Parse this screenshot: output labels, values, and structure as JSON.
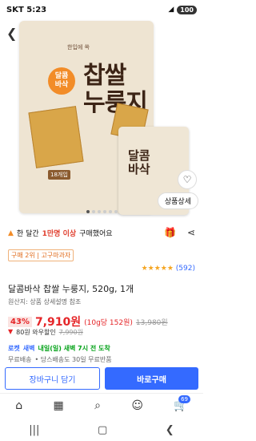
{
  "status": {
    "time": "SKT 5:23",
    "battery": "100"
  },
  "product_image": {
    "title_big": "찹쌀\n누룽지",
    "title_small": "달콤\n바삭",
    "badge": "달콤\n바삭",
    "subtitle": "한입에 쏙",
    "tag": "18개입"
  },
  "actions": {
    "detail_label": "상품상세"
  },
  "carousel": {
    "total": 6,
    "active": 1
  },
  "buyers": {
    "prefix": "한 달간",
    "count": "1만명 이상",
    "suffix": "구매했어요"
  },
  "rank": "구매 2위 | 고구마과자",
  "rating": {
    "stars": "★★★★★",
    "count": "(592)"
  },
  "product_title": "달콤바삭 찹쌀 누룽지, 520g, 1개",
  "origin": "원산지: 상품 상세설명 참조",
  "price": {
    "discount": "43%",
    "price": "7,910원",
    "unit": "(10g당 152원)",
    "original": "13,980원"
  },
  "wow": {
    "points": "80원 와우할인",
    "orig": "7,990원"
  },
  "delivery": {
    "rocket": "로켓",
    "tag": "새벽",
    "eta": "내일(일) 새벽 7시 전 도착"
  },
  "free_shipping": {
    "left": "무료배송",
    "right": "• 당스배송도 30일 무료반품"
  },
  "buttons": {
    "cart": "장바구니 담기",
    "buy": "바로구매"
  },
  "tabbar": {
    "cart_count": "69"
  }
}
